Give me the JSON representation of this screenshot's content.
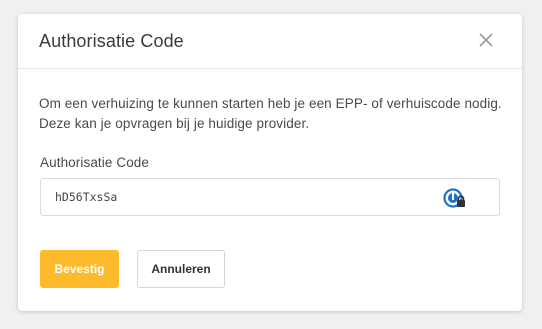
{
  "dialog": {
    "title": "Authorisatie Code",
    "description": "Om een verhuizing te kunnen starten heb je een EPP- of verhuiscode nodig. Deze kan je opvragen bij je huidige provider.",
    "field": {
      "label": "Authorisatie Code",
      "value": "hD56TxsSa",
      "icon": "password-manager-icon"
    },
    "buttons": {
      "confirm_label": "Bevestig",
      "cancel_label": "Annuleren"
    },
    "close_icon": "close-icon"
  },
  "colors": {
    "accent": "#fdbb2c",
    "background": "#f0f0f0",
    "dialog": "#ffffff",
    "icon_blue": "#1a73c9"
  }
}
